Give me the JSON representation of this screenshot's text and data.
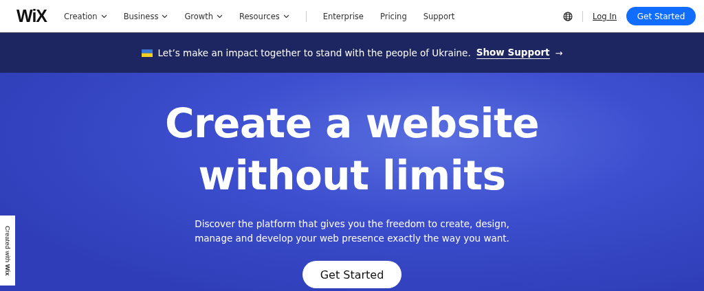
{
  "header": {
    "logo": "WiX",
    "nav": [
      {
        "label": "Creation",
        "dropdown": true
      },
      {
        "label": "Business",
        "dropdown": true
      },
      {
        "label": "Growth",
        "dropdown": true
      },
      {
        "label": "Resources",
        "dropdown": true
      },
      {
        "label": "Enterprise",
        "dropdown": false
      },
      {
        "label": "Pricing",
        "dropdown": false
      },
      {
        "label": "Support",
        "dropdown": false
      }
    ],
    "login": "Log In",
    "cta": "Get Started"
  },
  "banner": {
    "text": "Let’s make an impact together to stand with the people of Ukraine.",
    "link": "Show Support",
    "arrow": "→"
  },
  "hero": {
    "title_lines": [
      "Create a website",
      "without limits"
    ],
    "subtitle_lines": [
      "Discover the platform that gives you the freedom to create, design,",
      "manage and develop your web presence exactly the way you want."
    ],
    "button": "Get Started"
  },
  "badge": "Created with **Wix**"
}
